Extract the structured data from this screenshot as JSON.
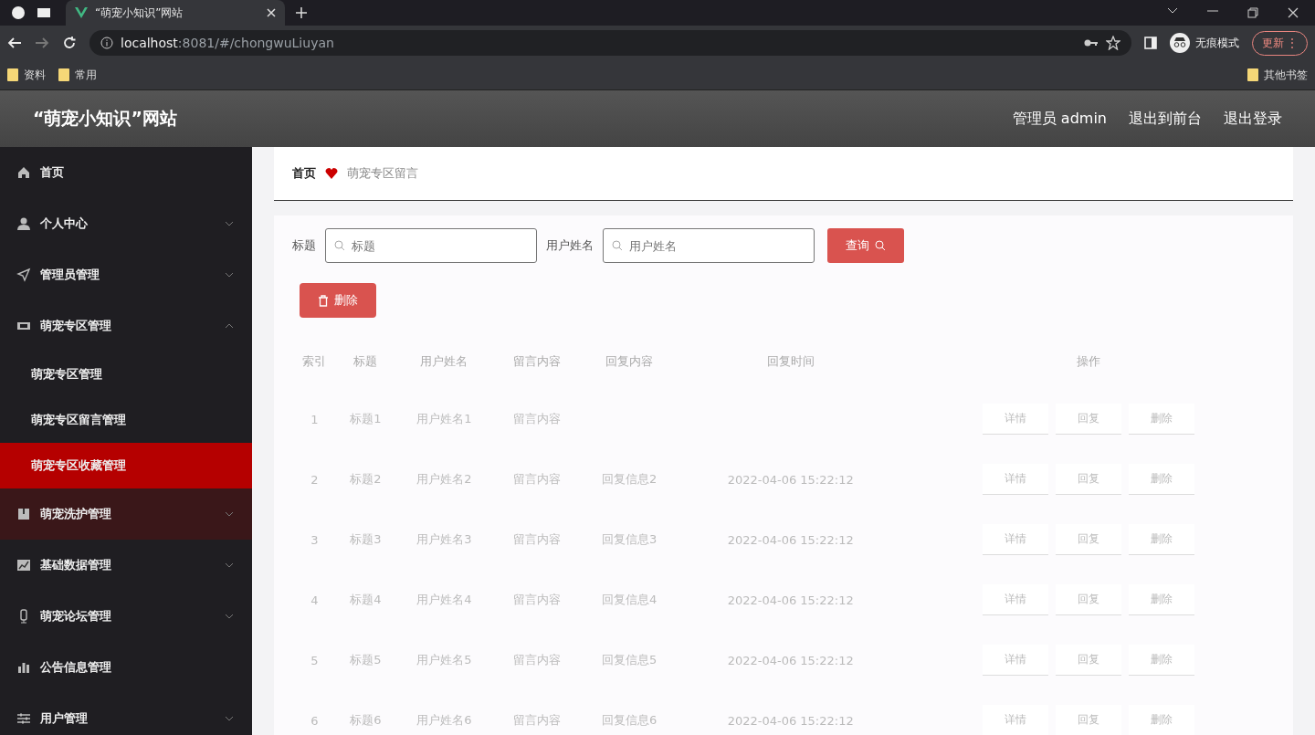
{
  "browser": {
    "tab_title": "“萌宠小知识”网站",
    "url_host": "localhost",
    "url_rest": ":8081/#/chongwuLiuyan",
    "profile_label": "无痕模式",
    "update_button": "更新",
    "menu_glyph": "⋮",
    "bookmarks": [
      "资料",
      "常用"
    ],
    "other_bookmarks": "其他书签"
  },
  "header": {
    "site_title": "“萌宠小知识”网站",
    "links": [
      "管理员 admin",
      "退出到前台",
      "退出登录"
    ]
  },
  "sidebar": {
    "items": [
      {
        "label": "首页",
        "kind": "link",
        "hovered": false
      },
      {
        "label": "个人中心",
        "kind": "group",
        "expanded": false,
        "hovered": false
      },
      {
        "label": "管理员管理",
        "kind": "group",
        "expanded": false,
        "hovered": false
      },
      {
        "label": "萌宠专区管理",
        "kind": "group",
        "expanded": true,
        "hovered": false,
        "children": [
          {
            "label": "萌宠专区管理",
            "selected": false
          },
          {
            "label": "萌宠专区留言管理",
            "selected": false
          },
          {
            "label": "萌宠专区收藏管理",
            "selected": true
          }
        ]
      },
      {
        "label": "萌宠洗护管理",
        "kind": "group",
        "expanded": false,
        "hovered": true
      },
      {
        "label": "基础数据管理",
        "kind": "group",
        "expanded": false,
        "hovered": false
      },
      {
        "label": "萌宠论坛管理",
        "kind": "group",
        "expanded": false,
        "hovered": false
      },
      {
        "label": "公告信息管理",
        "kind": "link",
        "hovered": false
      },
      {
        "label": "用户管理",
        "kind": "group",
        "expanded": false,
        "hovered": false
      }
    ]
  },
  "breadcrumb": [
    "首页",
    "萌宠专区留言"
  ],
  "search": {
    "fields": [
      {
        "label": "标题",
        "placeholder": "标题"
      },
      {
        "label": "用户姓名",
        "placeholder": "用户姓名"
      }
    ],
    "button": "查询"
  },
  "delete_button": "删除",
  "table": {
    "columns": [
      "索引",
      "标题",
      "用户姓名",
      "留言内容",
      "回复内容",
      "回复时间",
      "操作"
    ],
    "rows": [
      {
        "cells": [
          "1",
          "标题1",
          "用户姓名1",
          "留言内容",
          "",
          ""
        ],
        "actions": [
          "详情",
          "回复",
          "删除"
        ]
      },
      {
        "cells": [
          "2",
          "标题2",
          "用户姓名2",
          "留言内容",
          "回复信息2",
          "2022-04-06 15:22:12"
        ],
        "actions": [
          "详情",
          "回复",
          "删除"
        ]
      },
      {
        "cells": [
          "3",
          "标题3",
          "用户姓名3",
          "留言内容",
          "回复信息3",
          "2022-04-06 15:22:12"
        ],
        "actions": [
          "详情",
          "回复",
          "删除"
        ]
      },
      {
        "cells": [
          "4",
          "标题4",
          "用户姓名4",
          "留言内容",
          "回复信息4",
          "2022-04-06 15:22:12"
        ],
        "actions": [
          "详情",
          "回复",
          "删除"
        ]
      },
      {
        "cells": [
          "5",
          "标题5",
          "用户姓名5",
          "留言内容",
          "回复信息5",
          "2022-04-06 15:22:12"
        ],
        "actions": [
          "详情",
          "回复",
          "删除"
        ]
      },
      {
        "cells": [
          "6",
          "标题6",
          "用户姓名6",
          "留言内容",
          "回复信息6",
          "2022-04-06 15:22:12"
        ],
        "actions": [
          "详情",
          "回复",
          "删除"
        ]
      }
    ]
  }
}
